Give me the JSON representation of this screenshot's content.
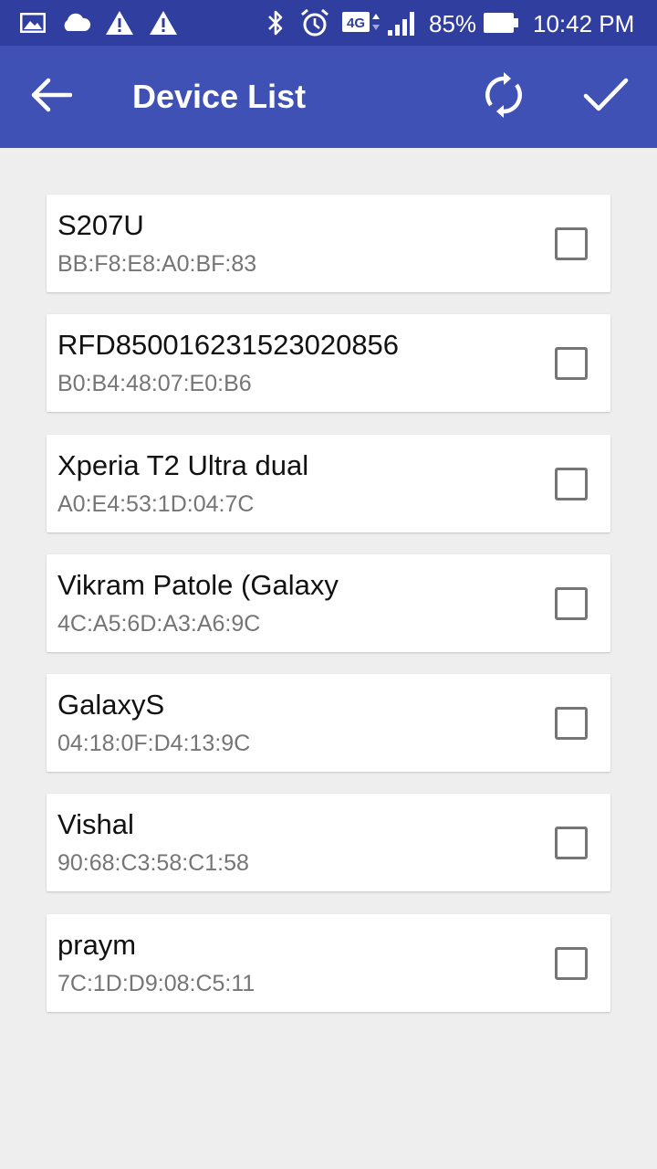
{
  "status_bar": {
    "battery": "85%",
    "time": "10:42 PM",
    "network_type": "4G",
    "icons": [
      "image-icon",
      "cloud-icon",
      "warning-icon",
      "warning-icon",
      "bluetooth-icon",
      "alarm-icon",
      "network-4g-icon",
      "signal-icon",
      "battery-icon"
    ]
  },
  "app_bar": {
    "title": "Device List",
    "actions": [
      "back-arrow-icon",
      "refresh-icon",
      "check-icon"
    ],
    "color": "#3f51b5",
    "status_color": "#303f9f"
  },
  "devices": [
    {
      "name": "S207U",
      "mac": "BB:F8:E8:A0:BF:83",
      "checked": false
    },
    {
      "name": "RFD8500162315230208​56",
      "mac": "B0:B4:48:07:E0:B6",
      "checked": false
    },
    {
      "name": "Xperia T2 Ultra dual",
      "mac": "A0:E4:53:1D:04:7C",
      "checked": false
    },
    {
      "name": "Vikram Patole (Galaxy",
      "mac": "4C:A5:6D:A3:A6:9C",
      "checked": false
    },
    {
      "name": "GalaxyS",
      "mac": "04:18:0F:D4:13:9C",
      "checked": false
    },
    {
      "name": "Vishal",
      "mac": "90:68:C3:58:C1:58",
      "checked": false
    },
    {
      "name": "praym",
      "mac": "7C:1D:D9:08:C5:11",
      "checked": false
    }
  ]
}
